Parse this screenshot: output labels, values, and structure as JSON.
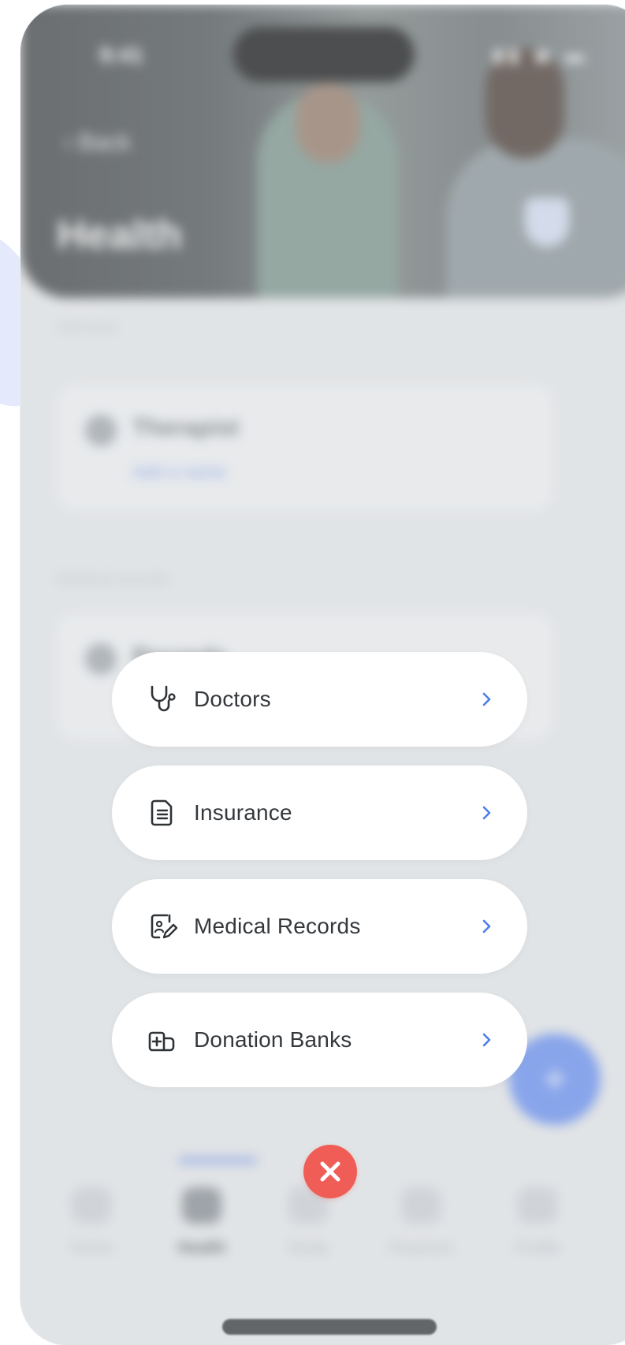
{
  "background_app": {
    "status_time": "9:41",
    "back_label": "‹ Back",
    "title": "Health",
    "services_section_title": "Services",
    "therapist_card": {
      "label": "Therapist",
      "link": "Add a name"
    },
    "records_section_title": "Medical records",
    "records_card": {
      "label": "Records"
    },
    "fab_label": "+",
    "tabs": [
      {
        "label": "Home",
        "icon": "home-icon"
      },
      {
        "label": "Health",
        "icon": "health-icon"
      },
      {
        "label": "Study",
        "icon": "study-icon"
      },
      {
        "label": "Finances",
        "icon": "finances-icon"
      },
      {
        "label": "Profile",
        "icon": "profile-icon"
      }
    ]
  },
  "menu": {
    "items": [
      {
        "label": "Doctors",
        "icon": "stethoscope-icon"
      },
      {
        "label": "Insurance",
        "icon": "document-icon"
      },
      {
        "label": "Medical Records",
        "icon": "medical-record-edit-icon"
      },
      {
        "label": "Donation Banks",
        "icon": "medical-bag-icon"
      }
    ],
    "close_icon": "close-icon"
  },
  "colors": {
    "chevron": "#4a7df0",
    "close_button": "#f05d56",
    "menu_text": "#34383c",
    "fab": "#5b86f0"
  }
}
